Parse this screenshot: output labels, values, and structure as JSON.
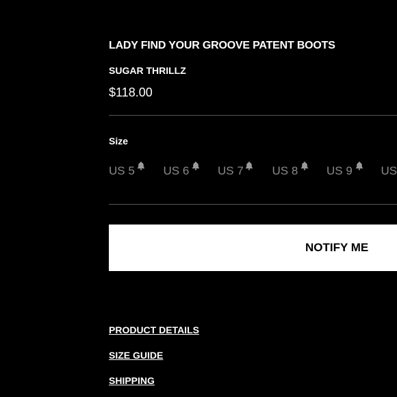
{
  "product": {
    "title": "LADY FIND YOUR GROOVE PATENT BOOTS",
    "brand": "SUGAR THRILLZ",
    "price": "$118.00"
  },
  "size_selector": {
    "label": "Size",
    "options": [
      {
        "label": "US 5",
        "available": false,
        "icon": "bell-icon"
      },
      {
        "label": "US 6",
        "available": false,
        "icon": "bell-icon"
      },
      {
        "label": "US 7",
        "available": false,
        "icon": "bell-icon"
      },
      {
        "label": "US 8",
        "available": false,
        "icon": "bell-icon"
      },
      {
        "label": "US 9",
        "available": false,
        "icon": "bell-icon"
      },
      {
        "label": "US",
        "available": false,
        "icon": "bell-icon"
      }
    ]
  },
  "notify_button": {
    "label": "NOTIFY ME"
  },
  "links": {
    "product_details": "PRODUCT DETAILS",
    "size_guide": "SIZE GUIDE",
    "shipping": "SHIPPING"
  },
  "colors": {
    "background": "#000000",
    "text": "#ffffff",
    "unavailable_size": "#8a8a8a",
    "divider": "#555555",
    "button_bg": "#ffffff",
    "button_text": "#000000"
  }
}
